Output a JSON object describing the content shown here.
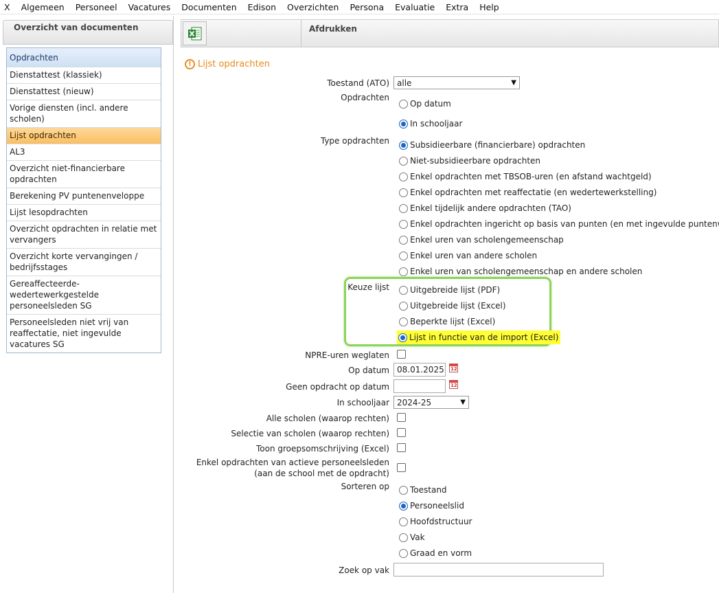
{
  "menu": [
    "X",
    "Algemeen",
    "Personeel",
    "Vacatures",
    "Documenten",
    "Edison",
    "Overzichten",
    "Persona",
    "Evaluatie",
    "Extra",
    "Help"
  ],
  "sidebar": {
    "header": "Overzicht van documenten",
    "items": [
      "Opdrachten",
      "Dienstattest (klassiek)",
      "Dienstattest (nieuw)",
      "Vorige diensten (incl. andere scholen)",
      "Lijst opdrachten",
      "AL3",
      "Overzicht niet-financierbare opdrachten",
      "Berekening PV puntenenveloppe",
      "Lijst lesopdrachten",
      "Overzicht opdrachten in relatie met vervangers",
      "Overzicht korte vervangingen / bedrijfsstages",
      "Gereaffecteerde-wedertewerkgestelde personeelsleden SG",
      "Personeelsleden niet vrij van reaffectatie, niet ingevulde vacatures SG"
    ],
    "active_item": "Lijst opdrachten"
  },
  "toolbar": {
    "excel_icon": "excel-icon",
    "title": "Afdrukken"
  },
  "page": {
    "title": "Lijst opdrachten",
    "title_icon": "warning-icon"
  },
  "form": {
    "toestand": {
      "label": "Toestand (ATO)",
      "value": "alle"
    },
    "opdrachten": {
      "label": "Opdrachten",
      "options": [
        "Op datum",
        "In schooljaar"
      ],
      "selected": "In schooljaar"
    },
    "type_opdrachten": {
      "label": "Type opdrachten",
      "options": [
        "Subsidieerbare (financierbare) opdrachten",
        "Niet-subsidieerbare opdrachten",
        "Enkel opdrachten met TBSOB-uren (en afstand wachtgeld)",
        "Enkel opdrachten met reaffectatie (en wedertewerkstelling)",
        "Enkel tijdelijk andere opdrachten (TAO)",
        "Enkel opdrachten ingericht op basis van punten (en met ingevulde puntenwaarde)",
        "Enkel uren van scholengemeenschap",
        "Enkel uren van andere scholen",
        "Enkel uren van scholengemeenschap en andere scholen"
      ],
      "selected": "Subsidieerbare (financierbare) opdrachten"
    },
    "keuze_lijst": {
      "label": "Keuze lijst",
      "options": [
        "Uitgebreide lijst (PDF)",
        "Uitgebreide lijst (Excel)",
        "Beperkte lijst (Excel)",
        "Lijst in functie van de import (Excel)"
      ],
      "selected": "Lijst in functie van de import (Excel)",
      "highlight_color": "#ffff33",
      "box_color": "#8cd35a"
    },
    "npre": {
      "label": "NPRE-uren weglaten",
      "checked": false
    },
    "op_datum": {
      "label": "Op datum",
      "value": "08.01.2025",
      "cal_text": "12"
    },
    "geen_opdracht": {
      "label": "Geen opdracht op datum",
      "value": "",
      "cal_text": "12"
    },
    "in_schooljaar": {
      "label": "In schooljaar",
      "value": "2024-25"
    },
    "alle_scholen": {
      "label": "Alle scholen (waarop rechten)",
      "checked": false
    },
    "selectie_scholen": {
      "label": "Selectie van scholen (waarop rechten)",
      "checked": false
    },
    "groepsomschrijving": {
      "label": "Toon groepsomschrijving (Excel)",
      "checked": false
    },
    "actieve": {
      "label": "Enkel opdrachten van actieve personeelsleden    (aan de school met de opdracht)",
      "checked": false
    },
    "sorteren": {
      "label": "Sorteren op",
      "options": [
        "Toestand",
        "Personeelslid",
        "Hoofdstructuur",
        "Vak",
        "Graad en vorm"
      ],
      "selected": "Personeelslid"
    },
    "zoek_op_vak": {
      "label": "Zoek op vak",
      "value": ""
    }
  }
}
